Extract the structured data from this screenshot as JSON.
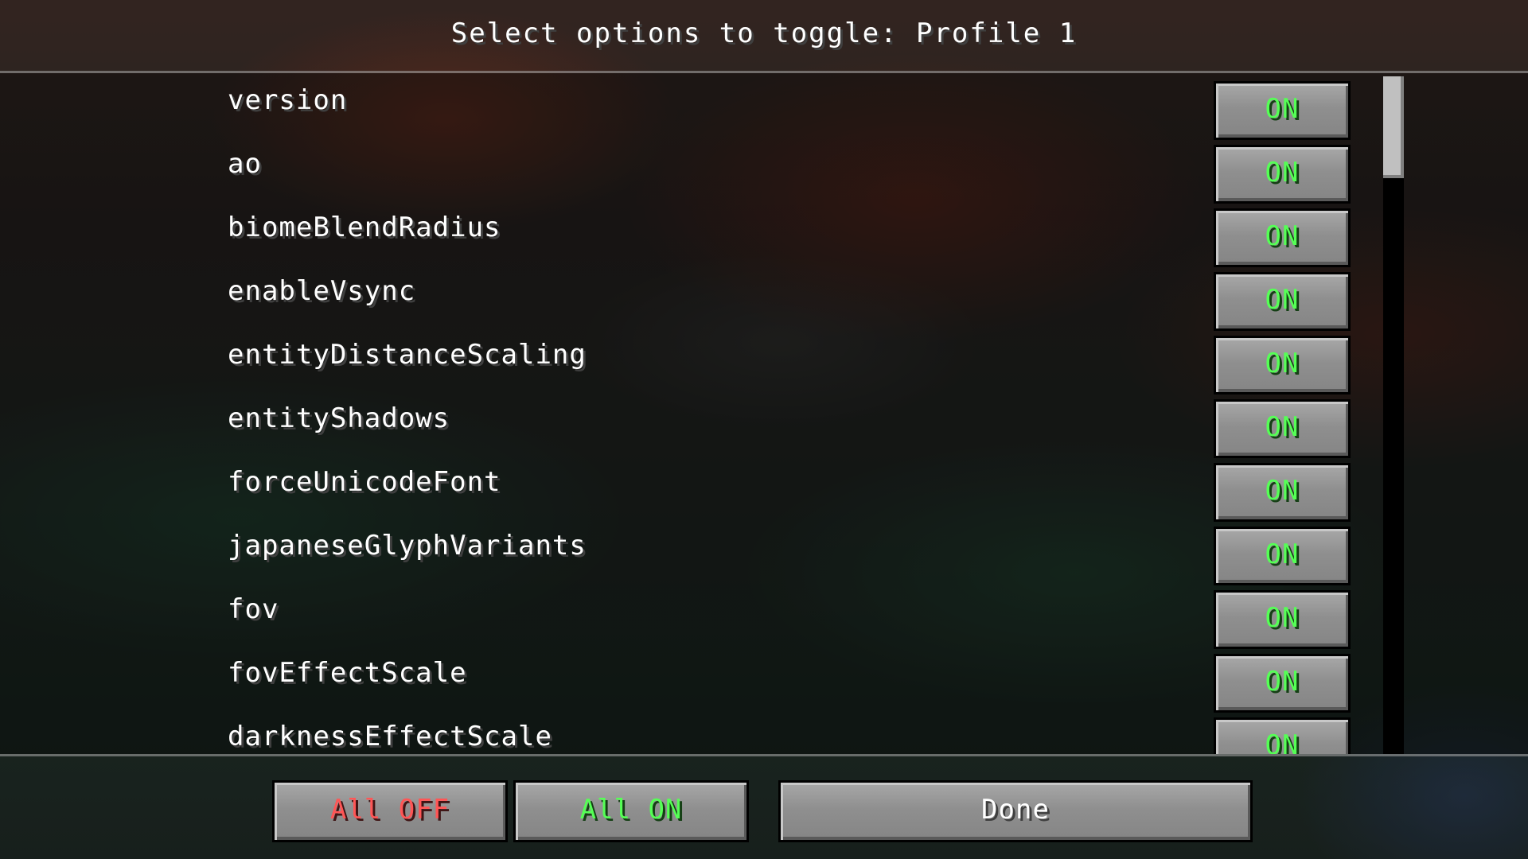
{
  "header": {
    "title": "Select options to toggle: Profile 1"
  },
  "options": [
    {
      "label": "version",
      "state": "ON"
    },
    {
      "label": "ao",
      "state": "ON"
    },
    {
      "label": "biomeBlendRadius",
      "state": "ON"
    },
    {
      "label": "enableVsync",
      "state": "ON"
    },
    {
      "label": "entityDistanceScaling",
      "state": "ON"
    },
    {
      "label": "entityShadows",
      "state": "ON"
    },
    {
      "label": "forceUnicodeFont",
      "state": "ON"
    },
    {
      "label": "japaneseGlyphVariants",
      "state": "ON"
    },
    {
      "label": "fov",
      "state": "ON"
    },
    {
      "label": "fovEffectScale",
      "state": "ON"
    },
    {
      "label": "darknessEffectScale",
      "state": "ON"
    }
  ],
  "footer": {
    "all_off_label": "All OFF",
    "all_on_label": "All ON",
    "done_label": "Done"
  },
  "colors": {
    "on_text": "#55ff55",
    "off_text": "#ff5555",
    "label_text": "#ffffff"
  }
}
